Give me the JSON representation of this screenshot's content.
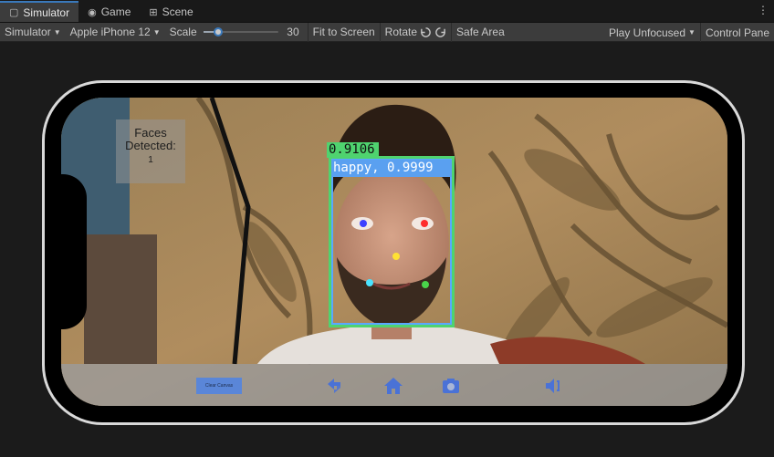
{
  "tabs": [
    {
      "label": "Simulator",
      "icon": "simulator-icon",
      "active": true
    },
    {
      "label": "Game",
      "icon": "gamepad-icon",
      "active": false
    },
    {
      "label": "Scene",
      "icon": "scene-icon",
      "active": false
    }
  ],
  "toolbar": {
    "mode_dropdown": "Simulator",
    "device_dropdown": "Apple iPhone 12",
    "scale_label": "Scale",
    "scale_value": "30",
    "scale_fraction": 0.16,
    "fit_to_screen": "Fit to Screen",
    "rotate": "Rotate",
    "safe_area": "Safe Area",
    "play_mode": "Play Unfocused",
    "control_panel": "Control Pane"
  },
  "app": {
    "faces_label": "Faces Detected:",
    "faces_count": "1",
    "detection_score": "0.9106",
    "emotion_label": "happy, 0.9999",
    "clear_button": "Clear Canvas"
  },
  "colors": {
    "box_green": "#4fd36f",
    "label_blue": "#5aa0f0",
    "accent": "#3a79bb"
  }
}
